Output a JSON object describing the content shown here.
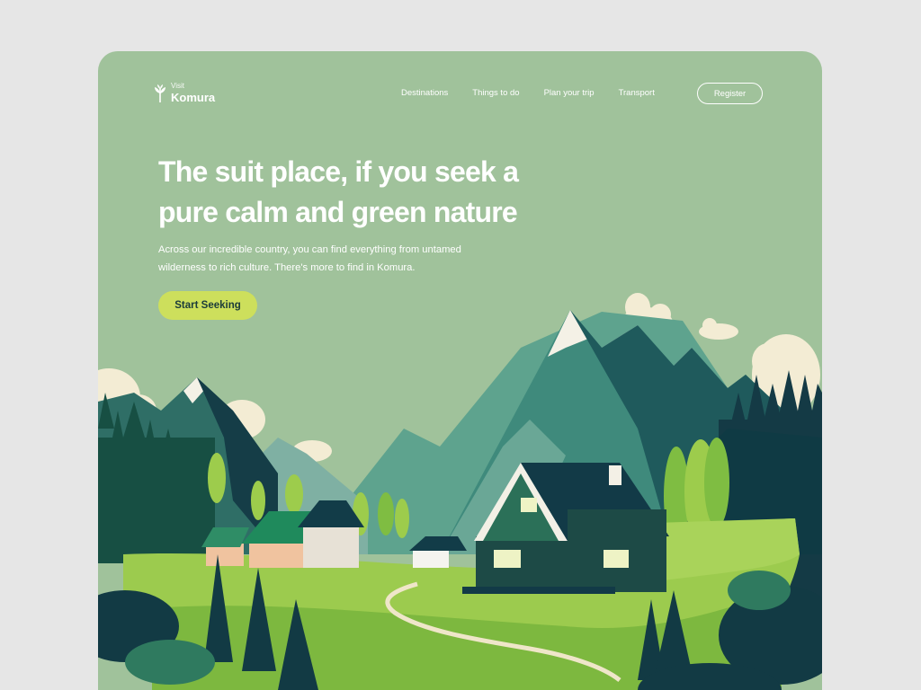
{
  "brand": {
    "small": "Visit",
    "name": "Komura"
  },
  "nav": {
    "items": [
      {
        "label": "Destinations"
      },
      {
        "label": "Things to do"
      },
      {
        "label": "Plan your trip"
      },
      {
        "label": "Transport"
      }
    ],
    "register_label": "Register"
  },
  "hero": {
    "headline_line1": "The suit place, if you seek a",
    "headline_line2": "pure calm and green nature",
    "subtext_line1": "Across our incredible country, you can find everything from untamed",
    "subtext_line2": "wilderness to rich culture. There's more to find in Komura.",
    "cta_label": "Start Seeking"
  },
  "colors": {
    "page_bg": "#e6e6e6",
    "card_bg": "#a0c29b",
    "cta_bg": "#cddf5c",
    "dark_forest": "#173a46",
    "meadow": "#9ccb4e"
  },
  "icons": {
    "logo": "plant-sprout-icon"
  }
}
